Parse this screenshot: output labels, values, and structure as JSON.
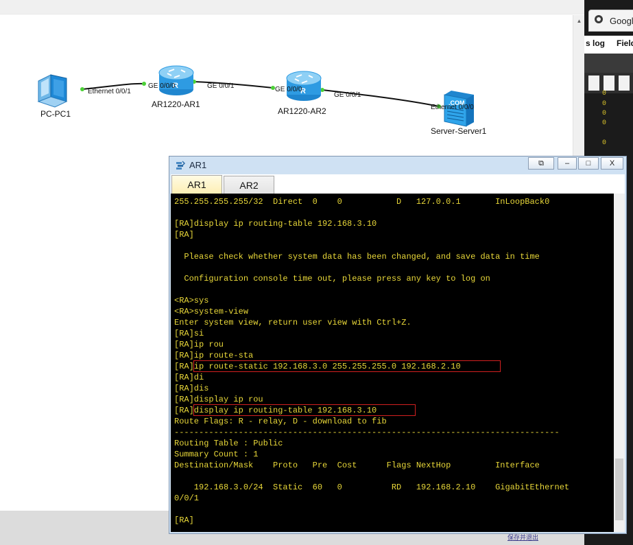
{
  "topology": {
    "devices": [
      {
        "label": "PC-PC1",
        "icon": "pc-icon"
      },
      {
        "label": "AR1220-AR1",
        "icon": "router-icon"
      },
      {
        "label": "AR1220-AR2",
        "icon": "router-icon"
      },
      {
        "label": "Server-Server1",
        "icon": "server-icon"
      }
    ],
    "ports": {
      "pc1_eth": "Ethernet 0/0/1",
      "ar1_ge000": "GE 0/0/0",
      "ar1_ge001": "GE 0/0/1",
      "ar2_ge000": "GE 0/0/0",
      "ar2_ge001": "GE 0/0/1",
      "server_eth": "Ethernet 0/0/0"
    },
    "server_badge": ".COM",
    "router_badge": "R"
  },
  "browser": {
    "tab_title": "Googl",
    "menu": [
      "s log",
      "Field"
    ],
    "zeros": [
      "0",
      "0",
      "0",
      "0",
      "0"
    ]
  },
  "bottom_link": "保存并退出",
  "window": {
    "title": "AR1",
    "controls": {
      "restore": "⧉",
      "minimize": "–",
      "maximize": "□",
      "close": "X"
    },
    "tabs": [
      {
        "label": "AR1",
        "active": true
      },
      {
        "label": "AR2",
        "active": false
      }
    ]
  },
  "console": {
    "lines": [
      "255.255.255.255/32  Direct  0    0           D   127.0.0.1       InLoopBack0",
      "",
      "[RA]display ip routing-table 192.168.3.10",
      "[RA]",
      "",
      "  Please check whether system data has been changed, and save data in time",
      "",
      "  Configuration console time out, please press any key to log on",
      "",
      "<RA>sys",
      "<RA>system-view",
      "Enter system view, return user view with Ctrl+Z.",
      "[RA]si",
      "[RA]ip rou",
      "[RA]ip route-sta",
      "[RA]ip route-static 192.168.3.0 255.255.255.0 192.168.2.10",
      "[RA]di",
      "[RA]dis",
      "[RA]display ip rou",
      "[RA]display ip routing-table 192.168.3.10",
      "Route Flags: R - relay, D - download to fib",
      "------------------------------------------------------------------------------",
      "Routing Table : Public",
      "Summary Count : 1",
      "Destination/Mask    Proto   Pre  Cost      Flags NextHop         Interface",
      "",
      "    192.168.3.0/24  Static  60   0          RD   192.168.2.10    GigabitEthernet",
      "0/0/1",
      "",
      "[RA]"
    ],
    "accent": "#e9d839",
    "highlight": "#d42020"
  }
}
